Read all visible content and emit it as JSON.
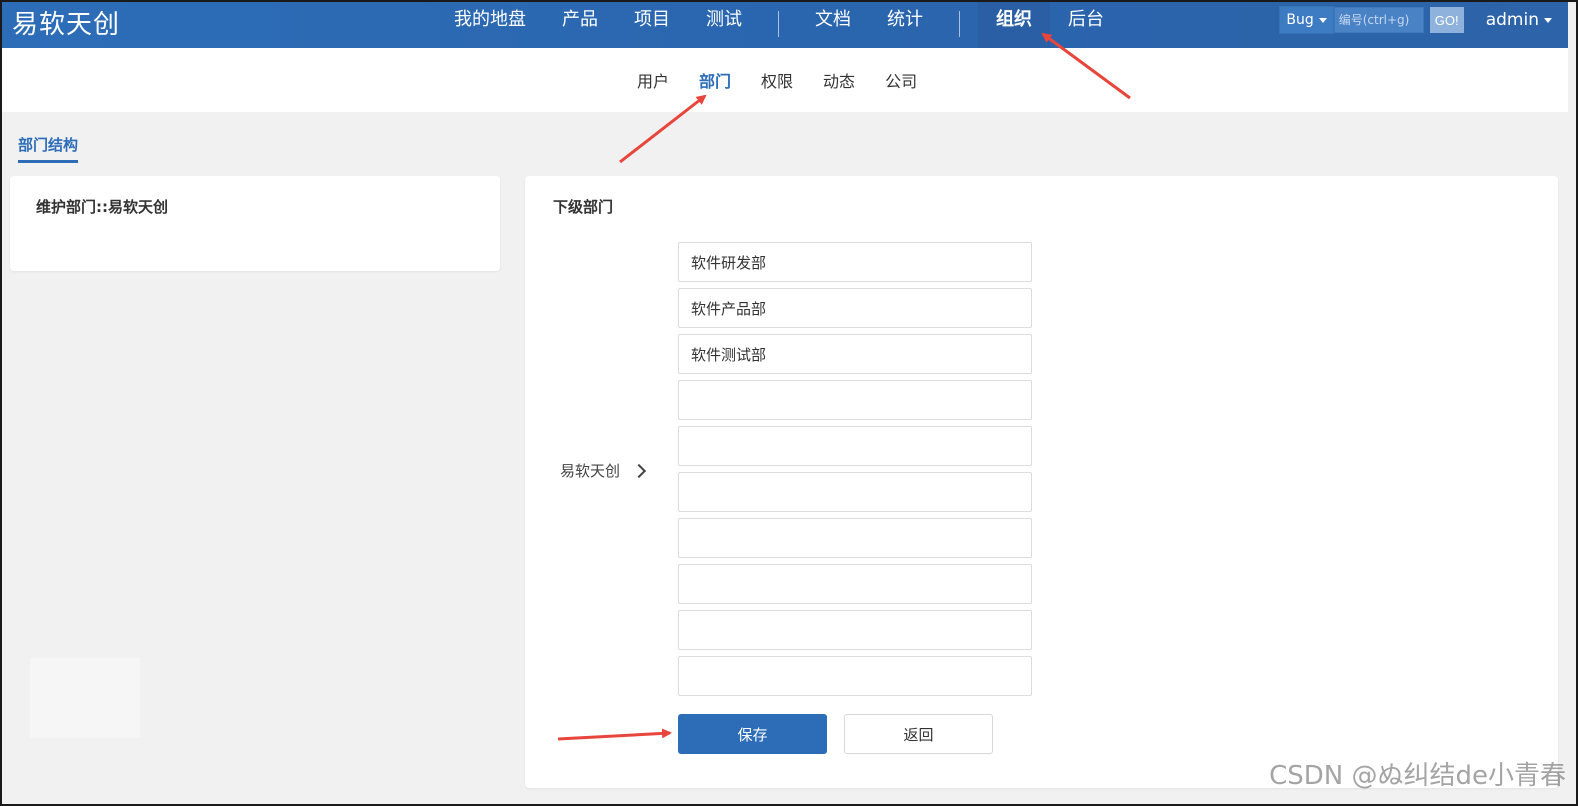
{
  "header": {
    "brand": "易软天创",
    "nav": [
      {
        "label": "我的地盘",
        "active": false
      },
      {
        "label": "产品",
        "active": false
      },
      {
        "label": "项目",
        "active": false
      },
      {
        "label": "测试",
        "active": false
      },
      {
        "label": "文档",
        "active": false
      },
      {
        "label": "统计",
        "active": false
      },
      {
        "label": "组织",
        "active": true
      },
      {
        "label": "后台",
        "active": false
      }
    ],
    "search": {
      "type_selected": "Bug",
      "placeholder": "编号(ctrl+g)",
      "go_label": "GO!"
    },
    "user": "admin"
  },
  "subnav": {
    "items": [
      {
        "label": "用户",
        "active": false
      },
      {
        "label": "部门",
        "active": true
      },
      {
        "label": "权限",
        "active": false
      },
      {
        "label": "动态",
        "active": false
      },
      {
        "label": "公司",
        "active": false
      }
    ]
  },
  "section_tab": "部门结构",
  "left_panel": {
    "title": "维护部门::易软天创"
  },
  "right_panel": {
    "title": "下级部门",
    "parent_label": "易软天创",
    "child_departments": [
      "软件研发部",
      "软件产品部",
      "软件测试部",
      "",
      "",
      "",
      "",
      "",
      "",
      ""
    ],
    "save_label": "保存",
    "back_label": "返回"
  },
  "watermark": "CSDN @ぬ纠结de小青春",
  "colors": {
    "primary": "#2d6db8",
    "annotation": "#e8453c",
    "page_bg": "#f1f1f1"
  }
}
